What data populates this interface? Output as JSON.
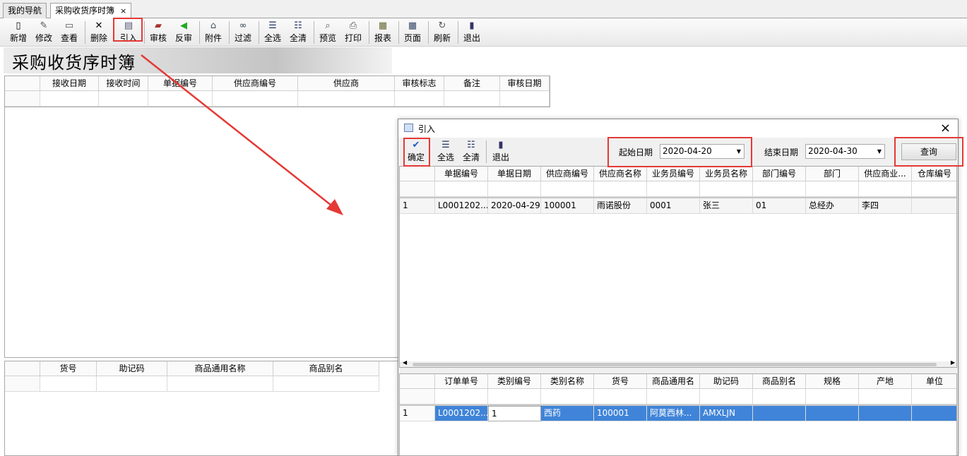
{
  "tabs": [
    {
      "label": "我的导航"
    },
    {
      "label": "采购收货序时簿"
    }
  ],
  "tab_close_glyph": "×",
  "toolbar": [
    {
      "label": "新增",
      "icon": "new-doc-icon"
    },
    {
      "label": "修改",
      "icon": "edit-icon"
    },
    {
      "label": "查看",
      "icon": "view-icon"
    },
    {
      "label": "删除",
      "icon": "delete-icon"
    },
    {
      "label": "引入",
      "icon": "import-icon"
    },
    {
      "label": "审核",
      "icon": "audit-icon"
    },
    {
      "label": "反审",
      "icon": "unaudit-icon"
    },
    {
      "label": "附件",
      "icon": "attachment-icon"
    },
    {
      "label": "过滤",
      "icon": "filter-icon"
    },
    {
      "label": "全选",
      "icon": "select-all-icon"
    },
    {
      "label": "全清",
      "icon": "clear-all-icon"
    },
    {
      "label": "预览",
      "icon": "preview-icon"
    },
    {
      "label": "打印",
      "icon": "print-icon"
    },
    {
      "label": "报表",
      "icon": "report-icon"
    },
    {
      "label": "页面",
      "icon": "page-icon"
    },
    {
      "label": "刷新",
      "icon": "refresh-icon"
    },
    {
      "label": "退出",
      "icon": "exit-icon"
    }
  ],
  "page_title": "采购收货序时簿",
  "main_grid": {
    "headers": [
      "接收日期",
      "接收时间",
      "单据编号",
      "供应商编号",
      "供应商",
      "审核标志",
      "备注",
      "审核日期"
    ]
  },
  "detail_grid": {
    "headers": [
      "货号",
      "助记码",
      "商品通用名称",
      "商品别名"
    ]
  },
  "dialog": {
    "title": "引入",
    "close_glyph": "×",
    "toolbar": [
      {
        "label": "确定",
        "icon": "confirm-check-icon"
      },
      {
        "label": "全选",
        "icon": "select-all-icon"
      },
      {
        "label": "全清",
        "icon": "clear-all-icon"
      },
      {
        "label": "退出",
        "icon": "exit-icon"
      }
    ],
    "start_date_label": "起始日期",
    "start_date": "2020-04-20",
    "end_date_label": "结束日期",
    "end_date": "2020-04-30",
    "query_label": "查询",
    "orders": {
      "headers": [
        "单据编号",
        "单据日期",
        "供应商编号",
        "供应商名称",
        "业务员编号",
        "业务员名称",
        "部门编号",
        "部门",
        "供应商业...",
        "仓库编号"
      ],
      "rows": [
        [
          "1",
          "L0001202...",
          "2020-04-29",
          "100001",
          "雨诺股份",
          "0001",
          "张三",
          "01",
          "总经办",
          "李四",
          ""
        ]
      ]
    },
    "items": {
      "headers": [
        "订单单号",
        "类别编号",
        "类别名称",
        "货号",
        "商品通用名",
        "助记码",
        "商品别名",
        "规格",
        "产地",
        "单位"
      ],
      "rows": [
        [
          "1",
          "L0001202...",
          "1",
          "西药",
          "100001",
          "阿莫西林...",
          "AMXLJN",
          "",
          "",
          "",
          ""
        ]
      ]
    }
  },
  "colors": {
    "highlight_box": "#e53935",
    "arrow": "#e53935",
    "selected_row": "#3f84d8"
  }
}
